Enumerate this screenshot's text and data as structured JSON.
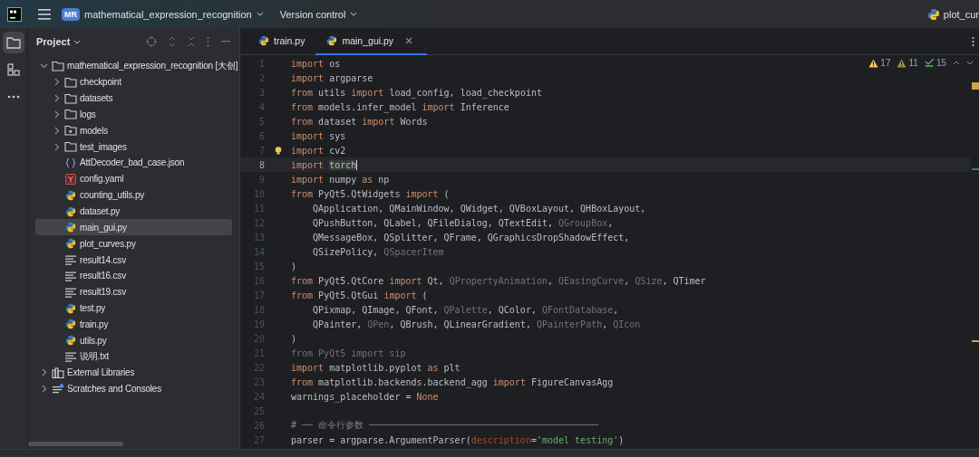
{
  "title_bar": {
    "project_badge": "MR",
    "project_name": "mathematical_expression_recognition",
    "vcs": "Version control",
    "open_file": "plot_cur"
  },
  "tool_strip": [
    {
      "kind": "folder",
      "selected": true
    },
    {
      "kind": "structure",
      "selected": false
    },
    {
      "kind": "more",
      "selected": false
    }
  ],
  "project_panel": {
    "title": "Project",
    "tree": [
      {
        "label": "mathematical_expression_recognition [大创]",
        "kind": "folder",
        "expanded": true,
        "selected": false,
        "children": [
          {
            "label": "checkpoint",
            "kind": "folder",
            "expanded": false,
            "selected": false
          },
          {
            "label": "datasets",
            "kind": "folder",
            "expanded": false,
            "selected": false
          },
          {
            "label": "logs",
            "kind": "folder",
            "expanded": false,
            "selected": false
          },
          {
            "label": "models",
            "kind": "module",
            "expanded": false,
            "selected": false
          },
          {
            "label": "test_images",
            "kind": "folder",
            "expanded": false,
            "selected": false
          },
          {
            "label": "AttDecoder_bad_case.json",
            "kind": "json",
            "selected": false
          },
          {
            "label": "config.yaml",
            "kind": "yaml",
            "selected": false
          },
          {
            "label": "counting_utils.py",
            "kind": "py",
            "selected": false
          },
          {
            "label": "dataset.py",
            "kind": "py",
            "selected": false
          },
          {
            "label": "main_gui.py",
            "kind": "py",
            "selected": true
          },
          {
            "label": "plot_curves.py",
            "kind": "py",
            "selected": false
          },
          {
            "label": "result14.csv",
            "kind": "text",
            "selected": false
          },
          {
            "label": "result16.csv",
            "kind": "text",
            "selected": false
          },
          {
            "label": "result19.csv",
            "kind": "text",
            "selected": false
          },
          {
            "label": "test.py",
            "kind": "py",
            "selected": false
          },
          {
            "label": "train.py",
            "kind": "py",
            "selected": false
          },
          {
            "label": "utils.py",
            "kind": "py",
            "selected": false
          },
          {
            "label": "说明.txt",
            "kind": "text",
            "selected": false
          }
        ]
      },
      {
        "label": "External Libraries",
        "kind": "library",
        "expanded": false,
        "selected": false
      },
      {
        "label": "Scratches and Consoles",
        "kind": "scratch",
        "expanded": false,
        "selected": false
      }
    ]
  },
  "tabs": [
    {
      "label": "train.py",
      "selected": false
    },
    {
      "label": "main_gui.py",
      "selected": true
    }
  ],
  "inspections": [
    {
      "kind": "warning",
      "count": "17"
    },
    {
      "kind": "weak",
      "count": "11"
    },
    {
      "kind": "typo",
      "count": "15"
    }
  ],
  "editor": {
    "lines": [
      {
        "number": "1",
        "current": false,
        "code": [
          {
            "t": "import",
            "kind": "kw"
          },
          {
            "t": " os",
            "kind": "id"
          }
        ]
      },
      {
        "number": "2",
        "current": false,
        "code": [
          {
            "t": "import",
            "kind": "kw"
          },
          {
            "t": " argparse",
            "kind": "id"
          }
        ]
      },
      {
        "number": "3",
        "current": false,
        "code": [
          {
            "t": "from",
            "kind": "kw"
          },
          {
            "t": " utils ",
            "kind": "id"
          },
          {
            "t": "import",
            "kind": "kw"
          },
          {
            "t": " load_config, load_checkpoint",
            "kind": "id"
          }
        ]
      },
      {
        "number": "4",
        "current": false,
        "code": [
          {
            "t": "from",
            "kind": "kw"
          },
          {
            "t": " models.infer_model ",
            "kind": "id"
          },
          {
            "t": "import",
            "kind": "kw"
          },
          {
            "t": " Inference",
            "kind": "id"
          }
        ]
      },
      {
        "number": "5",
        "current": false,
        "code": [
          {
            "t": "from",
            "kind": "kw"
          },
          {
            "t": " dataset ",
            "kind": "id"
          },
          {
            "t": "import",
            "kind": "kw"
          },
          {
            "t": " Words",
            "kind": "id"
          }
        ]
      },
      {
        "number": "6",
        "current": false,
        "code": [
          {
            "t": "import",
            "kind": "kw"
          },
          {
            "t": " sys",
            "kind": "id"
          }
        ]
      },
      {
        "number": "7",
        "current": false,
        "code": [
          {
            "t": "import",
            "kind": "kw"
          },
          {
            "t": " cv2",
            "kind": "id"
          }
        ]
      },
      {
        "number": "8",
        "current": true,
        "code": [
          {
            "t": "import ",
            "kind": "kw"
          },
          {
            "t": "torch",
            "kind": "hl"
          }
        ]
      },
      {
        "number": "9",
        "current": false,
        "code": [
          {
            "t": "import",
            "kind": "kw"
          },
          {
            "t": " numpy ",
            "kind": "id"
          },
          {
            "t": "as",
            "kind": "kw"
          },
          {
            "t": " np",
            "kind": "id"
          }
        ]
      },
      {
        "number": "10",
        "current": false,
        "code": [
          {
            "t": "from",
            "kind": "kw"
          },
          {
            "t": " PyQt5.QtWidgets ",
            "kind": "id"
          },
          {
            "t": "import",
            "kind": "kw"
          },
          {
            "t": " (",
            "kind": "id"
          }
        ]
      },
      {
        "number": "11",
        "current": false,
        "code": [
          {
            "t": "    QApplication, QMainWindow, QWidget, QVBoxLayout, QHBoxLayout,",
            "kind": "id"
          }
        ]
      },
      {
        "number": "12",
        "current": false,
        "code": [
          {
            "t": "    QPushButton, QLabel, QFileDialog, QTextEdit, ",
            "kind": "id"
          },
          {
            "t": "QGroupBox",
            "kind": "dim"
          },
          {
            "t": ",",
            "kind": "id"
          }
        ]
      },
      {
        "number": "13",
        "current": false,
        "code": [
          {
            "t": "    QMessageBox, QSplitter, QFrame, QGraphicsDropShadowEffect,",
            "kind": "id"
          }
        ]
      },
      {
        "number": "14",
        "current": false,
        "code": [
          {
            "t": "    QSizePolicy, ",
            "kind": "id"
          },
          {
            "t": "QSpacerItem",
            "kind": "dim"
          }
        ]
      },
      {
        "number": "15",
        "current": false,
        "code": [
          {
            "t": ")",
            "kind": "id"
          }
        ]
      },
      {
        "number": "16",
        "current": false,
        "code": [
          {
            "t": "from",
            "kind": "kw"
          },
          {
            "t": " PyQt5.QtCore ",
            "kind": "id"
          },
          {
            "t": "import",
            "kind": "kw"
          },
          {
            "t": " Qt, ",
            "kind": "id"
          },
          {
            "t": "QPropertyAnimation",
            "kind": "dim"
          },
          {
            "t": ", ",
            "kind": "id"
          },
          {
            "t": "QEasingCurve",
            "kind": "dim"
          },
          {
            "t": ", ",
            "kind": "id"
          },
          {
            "t": "QSize",
            "kind": "dim"
          },
          {
            "t": ", QTimer",
            "kind": "id"
          }
        ]
      },
      {
        "number": "17",
        "current": false,
        "code": [
          {
            "t": "from",
            "kind": "kw"
          },
          {
            "t": " PyQt5.QtGui ",
            "kind": "id"
          },
          {
            "t": "import",
            "kind": "kw"
          },
          {
            "t": " (",
            "kind": "id"
          }
        ]
      },
      {
        "number": "18",
        "current": false,
        "code": [
          {
            "t": "    QPixmap, QImage, QFont, ",
            "kind": "id"
          },
          {
            "t": "QPalette",
            "kind": "dim"
          },
          {
            "t": ", QColor, ",
            "kind": "id"
          },
          {
            "t": "QFontDatabase",
            "kind": "dim"
          },
          {
            "t": ",",
            "kind": "id"
          }
        ]
      },
      {
        "number": "19",
        "current": false,
        "code": [
          {
            "t": "    QPainter, ",
            "kind": "id"
          },
          {
            "t": "QPen",
            "kind": "dim"
          },
          {
            "t": ", QBrush, QLinearGradient, ",
            "kind": "id"
          },
          {
            "t": "QPainterPath",
            "kind": "dim"
          },
          {
            "t": ", ",
            "kind": "id"
          },
          {
            "t": "QIcon",
            "kind": "dim"
          }
        ]
      },
      {
        "number": "20",
        "current": false,
        "code": [
          {
            "t": ")",
            "kind": "id"
          }
        ]
      },
      {
        "number": "21",
        "current": false,
        "code": [
          {
            "t": "from PyQt5 import sip",
            "kind": "dim"
          }
        ]
      },
      {
        "number": "22",
        "current": false,
        "code": [
          {
            "t": "import",
            "kind": "kw"
          },
          {
            "t": " matplotlib.pyplot ",
            "kind": "id"
          },
          {
            "t": "as",
            "kind": "kw"
          },
          {
            "t": " plt",
            "kind": "id"
          }
        ]
      },
      {
        "number": "23",
        "current": false,
        "code": [
          {
            "t": "from",
            "kind": "kw"
          },
          {
            "t": " matplotlib.backends.backend_agg ",
            "kind": "id"
          },
          {
            "t": "import",
            "kind": "kw"
          },
          {
            "t": " FigureCanvasAgg",
            "kind": "id"
          }
        ]
      },
      {
        "number": "24",
        "current": false,
        "code": [
          {
            "t": "warnings_placeholder = ",
            "kind": "id"
          },
          {
            "t": "None",
            "kind": "kw"
          }
        ]
      },
      {
        "number": "25",
        "current": false
      },
      {
        "number": "26",
        "current": false,
        "code": [
          {
            "t": "# ── 命令行参数 ──────────────────────────────────────────",
            "kind": "comment"
          }
        ]
      },
      {
        "number": "27",
        "current": false,
        "code": [
          {
            "t": "parser = argparse.ArgumentParser(",
            "kind": "id"
          },
          {
            "t": "description",
            "kind": "param"
          },
          {
            "t": "=",
            "kind": "id"
          },
          {
            "t": "'model testing'",
            "kind": "str"
          },
          {
            "t": ")",
            "kind": "id"
          }
        ]
      }
    ]
  }
}
